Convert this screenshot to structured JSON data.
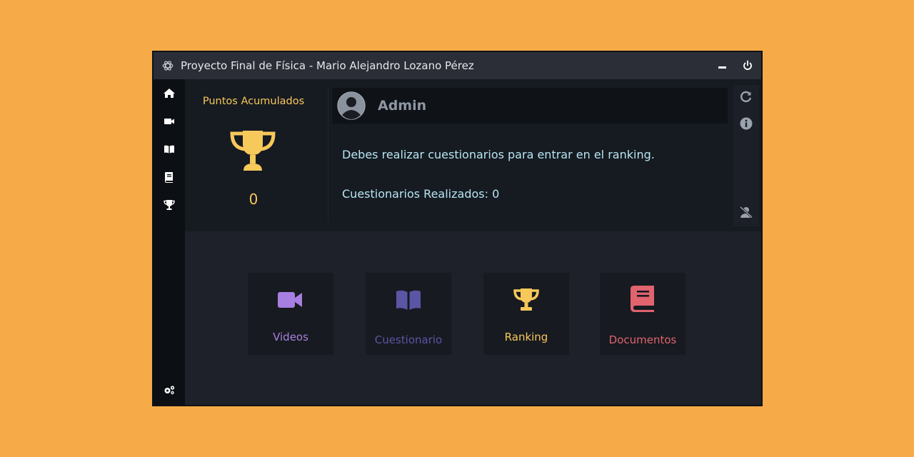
{
  "window": {
    "title": "Proyecto Final de Física - Mario Alejandro Lozano Pérez",
    "app_icon": "openai-knot-icon",
    "controls": [
      "minimize-icon",
      "power-icon"
    ]
  },
  "sidebar": {
    "items": [
      {
        "name": "home",
        "icon": "home-icon"
      },
      {
        "name": "videos",
        "icon": "video-camera-icon"
      },
      {
        "name": "cuestionario",
        "icon": "open-book-icon"
      },
      {
        "name": "documentos",
        "icon": "book-icon"
      },
      {
        "name": "ranking",
        "icon": "trophy-icon"
      }
    ],
    "settings_icon": "gears-icon"
  },
  "stats": {
    "points_title": "Puntos Acumulados",
    "points_value": "0",
    "user_name": "Admin",
    "ranking_message": "Debes realizar cuestionarios para entrar en el ranking.",
    "quizzes_done": "Cuestionarios Realizados: 0"
  },
  "side_actions": [
    "refresh-icon",
    "info-icon",
    "remove-user-icon"
  ],
  "tiles": [
    {
      "label": "Videos",
      "icon": "video-camera-icon",
      "color": "#a77fe0"
    },
    {
      "label": "Cuestionario",
      "icon": "open-book-icon",
      "color": "#5b55a6"
    },
    {
      "label": "Ranking",
      "icon": "trophy-icon",
      "color": "#f7c85a"
    },
    {
      "label": "Documentos",
      "icon": "book-icon",
      "color": "#e0636e"
    }
  ],
  "colors": {
    "background": "#F7AB48",
    "accent_gold": "#f7c85a",
    "text_cyan": "#b7e6f2"
  }
}
